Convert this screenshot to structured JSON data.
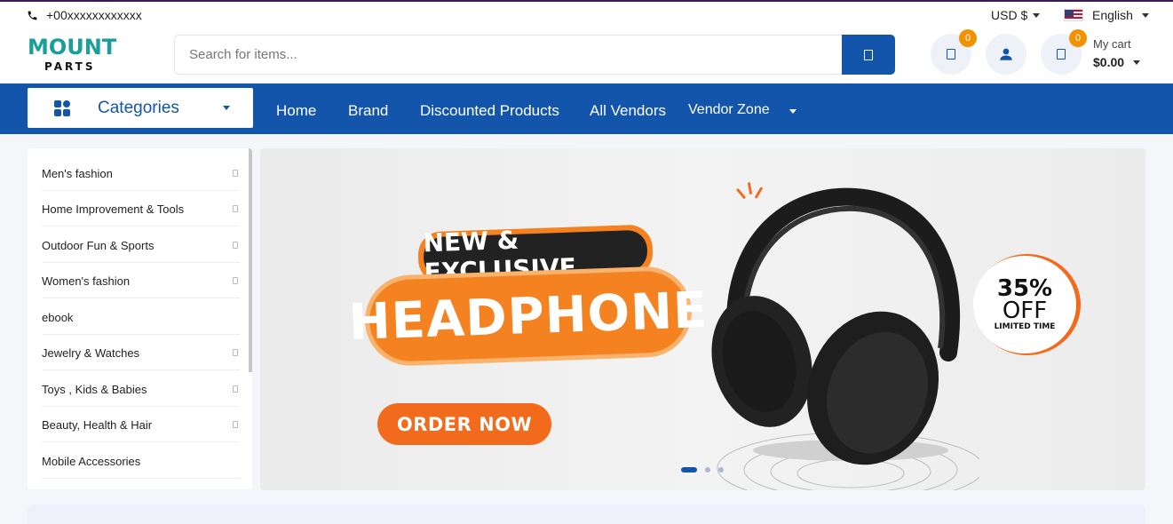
{
  "topbar": {
    "phone": "+00xxxxxxxxxxxx",
    "currency": "USD $",
    "language": "English"
  },
  "header": {
    "logo_top": "MOUNT",
    "logo_bottom": "PARTS",
    "search_placeholder": "Search for items...",
    "wishlist_count": "0",
    "cart_count": "0",
    "cart_label": "My cart",
    "cart_total": "$0.00"
  },
  "nav": {
    "categories_label": "Categories",
    "links": [
      "Home",
      "Brand",
      "Discounted Products",
      "All Vendors",
      "Vendor Zone"
    ]
  },
  "sidebar": {
    "items": [
      "Men's fashion",
      "Home Improvement & Tools",
      "Outdoor Fun & Sports",
      "Women's fashion",
      "ebook",
      "Jewelry & Watches",
      "Toys , Kids & Babies",
      "Beauty, Health & Hair",
      "Mobile Accessories"
    ]
  },
  "banner": {
    "line1": "NEW & EXCLUSIVE",
    "line2": "HEADPHONE",
    "cta": "ORDER NOW",
    "discount": "35%",
    "discount_off": "OFF",
    "discount_note": "LIMITED TIME",
    "slides": 3,
    "active_slide": 1
  },
  "colors": {
    "primary": "#1455ac",
    "accent": "#f58220",
    "badge": "#f39200",
    "logo": "#1a9e9a"
  }
}
